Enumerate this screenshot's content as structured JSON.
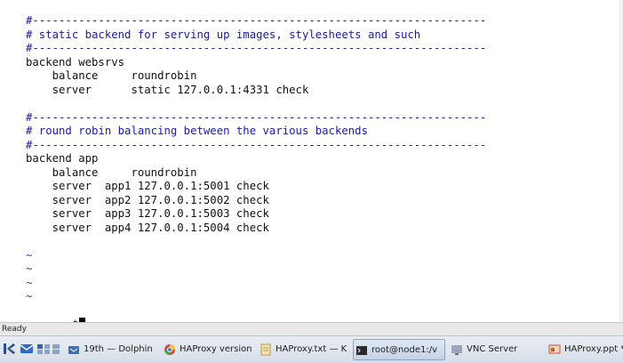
{
  "editor": {
    "lines": [
      {
        "kind": "comment",
        "text": "#---------------------------------------------------------------------"
      },
      {
        "kind": "comment",
        "text": "# static backend for serving up images, stylesheets and such"
      },
      {
        "kind": "comment",
        "text": "#---------------------------------------------------------------------"
      },
      {
        "kind": "code",
        "text": "backend websrvs"
      },
      {
        "kind": "code",
        "text": "    balance     roundrobin"
      },
      {
        "kind": "code",
        "text": "    server      static 127.0.0.1:4331 check"
      },
      {
        "kind": "blank",
        "text": ""
      },
      {
        "kind": "comment",
        "text": "#---------------------------------------------------------------------"
      },
      {
        "kind": "comment",
        "text": "# round robin balancing between the various backends"
      },
      {
        "kind": "comment",
        "text": "#---------------------------------------------------------------------"
      },
      {
        "kind": "code",
        "text": "backend app"
      },
      {
        "kind": "code",
        "text": "    balance     roundrobin"
      },
      {
        "kind": "code",
        "text": "    server  app1 127.0.0.1:5001 check"
      },
      {
        "kind": "code",
        "text": "    server  app2 127.0.0.1:5002 check"
      },
      {
        "kind": "code",
        "text": "    server  app3 127.0.0.1:5003 check"
      },
      {
        "kind": "code",
        "text": "    server  app4 127.0.0.1:5004 check"
      },
      {
        "kind": "blank",
        "text": ""
      },
      {
        "kind": "tilde",
        "text": "~"
      },
      {
        "kind": "tilde",
        "text": "~"
      },
      {
        "kind": "tilde",
        "text": "~"
      },
      {
        "kind": "tilde",
        "text": "~"
      }
    ],
    "command_line": ":.,$"
  },
  "status": {
    "text": "Ready"
  },
  "taskbar": {
    "tasks": [
      {
        "label": "19th — Dolphin",
        "icon": "folder-icon",
        "color": "#3b6fb6"
      },
      {
        "label": "HAProxy version",
        "icon": "chrome-icon",
        "color": "#d64b3b"
      },
      {
        "label": "HAProxy.txt — K",
        "icon": "text-editor-icon",
        "color": "#c9a44a"
      },
      {
        "label": "root@node1:/v",
        "icon": "terminal-icon",
        "color": "#2b2b2b"
      },
      {
        "label": "VNC Server",
        "icon": "vnc-icon",
        "color": "#6a6a6a"
      },
      {
        "label": "HAProxy.ppt *",
        "icon": "presentation-icon",
        "color": "#c0582c"
      }
    ]
  },
  "colors": {
    "comment": "#1c1c9c",
    "tilde": "#2a3fa8",
    "text": "#111111"
  }
}
